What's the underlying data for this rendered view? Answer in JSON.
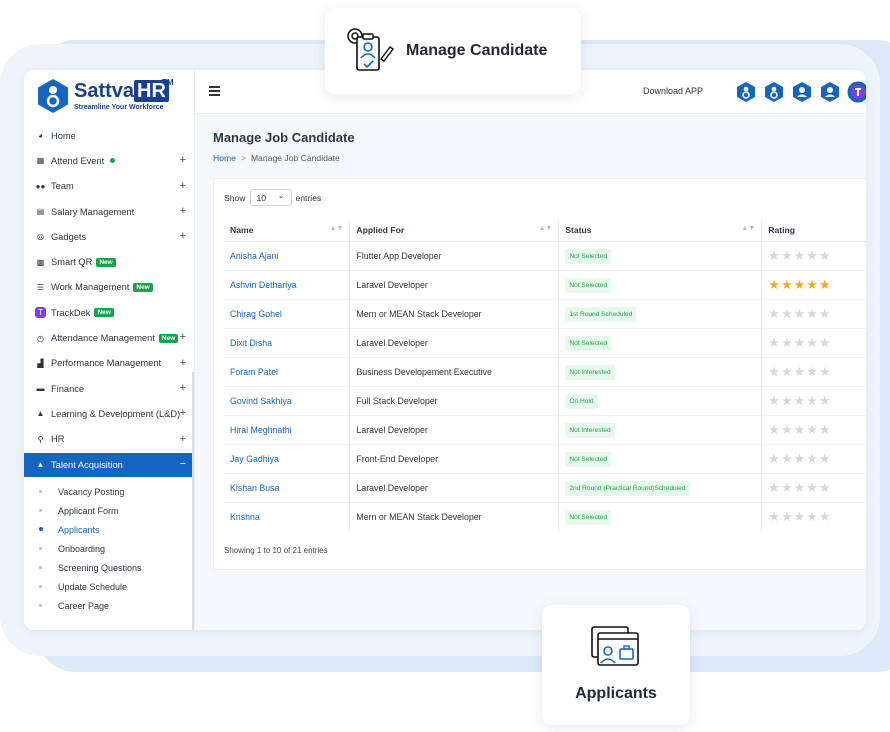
{
  "callouts": {
    "top_label": "Manage Candidate",
    "bottom_label": "Applicants"
  },
  "brand": {
    "name": "Sattva",
    "name_hr": "HR",
    "tm": "TM",
    "tagline": "Streamline Your Workforce",
    "primary_color": "#1565c0"
  },
  "sidebar": {
    "items": [
      {
        "label": "Home",
        "icon": "dashboard-icon",
        "plus": "",
        "extra": ""
      },
      {
        "label": "Attend Event",
        "icon": "calendar-icon",
        "plus": "+",
        "extra": "dot"
      },
      {
        "label": "Team",
        "icon": "users-icon",
        "plus": "+",
        "extra": ""
      },
      {
        "label": "Salary Management",
        "icon": "document-icon",
        "plus": "+",
        "extra": ""
      },
      {
        "label": "Gadgets",
        "icon": "gadget-icon",
        "plus": "+",
        "extra": ""
      },
      {
        "label": "Smart QR",
        "icon": "qr-icon",
        "plus": "",
        "extra": "New"
      },
      {
        "label": "Work Management",
        "icon": "list-icon",
        "plus": "",
        "extra": "New"
      },
      {
        "label": "TrackDek",
        "icon": "trackdek-icon",
        "plus": "",
        "extra": "New"
      },
      {
        "label": "Attendance Management",
        "icon": "clock-icon",
        "plus": "+",
        "extra": "New"
      },
      {
        "label": "Performance Management",
        "icon": "chart-icon",
        "plus": "+",
        "extra": ""
      },
      {
        "label": "Finance",
        "icon": "wallet-icon",
        "plus": "+",
        "extra": ""
      },
      {
        "label": "Learning & Development (L&D)",
        "icon": "graduation-icon",
        "plus": "+",
        "extra": ""
      },
      {
        "label": "HR",
        "icon": "user-key-icon",
        "plus": "+",
        "extra": ""
      },
      {
        "label": "Talent Acquisition",
        "icon": "person-icon",
        "plus": "−",
        "extra": "active"
      }
    ],
    "subitems": [
      "Vacancy Posting",
      "Applicant Form",
      "Applicants",
      "Onboarding",
      "Screening Questions",
      "Update Schedule",
      "Career Page"
    ]
  },
  "topbar": {
    "download_label": "Download APP"
  },
  "page": {
    "title": "Manage Job Candidate",
    "breadcrumb_home": "Home",
    "breadcrumb_sep": ">",
    "breadcrumb_current": "Manage Job Candidate"
  },
  "table": {
    "show_label": "Show",
    "entries_value": "10",
    "entries_label": "entries",
    "headers": [
      "Name",
      "Applied For",
      "Status",
      "Rating"
    ],
    "rows": [
      {
        "name": "Anisha Ajani",
        "applied": "Flutter App Developer",
        "status": "Not Selected",
        "rating": 0
      },
      {
        "name": "Ashvin Dethariya",
        "applied": "Laravel Developer",
        "status": "Not Selected",
        "rating": 5
      },
      {
        "name": "Chirag Gohel",
        "applied": "Mern or MEAN Stack Developer",
        "status": "1st Round Scheduled",
        "rating": 0
      },
      {
        "name": "Dixit Disha",
        "applied": "Laravel Developer",
        "status": "Not Selected",
        "rating": 0
      },
      {
        "name": "Foram Patel",
        "applied": "Business Developement Executive",
        "status": "Not Interested",
        "rating": 0
      },
      {
        "name": "Govind Sakhiya",
        "applied": "Full Stack Developer",
        "status": "On Hold",
        "rating": 0
      },
      {
        "name": "Hiral Meghnathi",
        "applied": "Laravel Developer",
        "status": "Not Interested",
        "rating": 0
      },
      {
        "name": "Jay Gadhiya",
        "applied": "Front-End Developer",
        "status": "Not Selected",
        "rating": 0
      },
      {
        "name": "Kishan Busa",
        "applied": "Laravel Developer",
        "status": "2nd Round (Practical Round)Scheduled",
        "rating": 0
      },
      {
        "name": "Krishna",
        "applied": "Mern or MEAN Stack Developer",
        "status": "Not Selected",
        "rating": 0
      }
    ],
    "info": "Showing 1 to 10 of 21 entries",
    "star_color": "#f5a623"
  }
}
